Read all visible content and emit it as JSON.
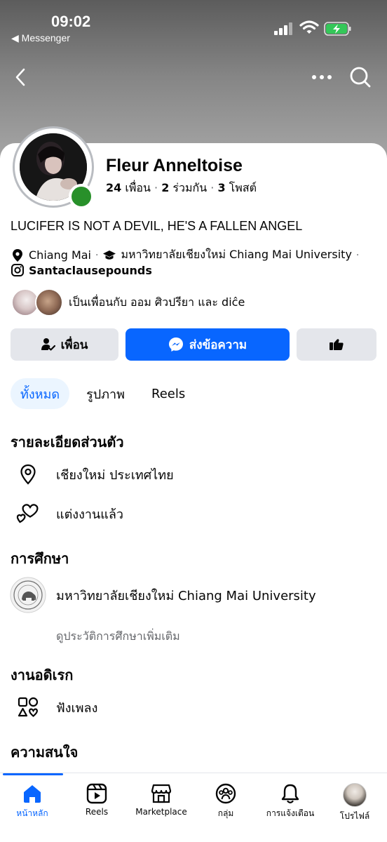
{
  "status_bar": {
    "time": "09:02",
    "back_app": "◀ Messenger"
  },
  "profile": {
    "name": "Fleur Anneltoise",
    "stats": {
      "friends": "24",
      "friends_label": "เพื่อน",
      "mutual": "2",
      "mutual_label": "ร่วมกัน",
      "posts": "3",
      "posts_label": "โพสต์"
    },
    "bio": "LUCIFER IS NOT A DEVIL, HE'S A FALLEN ANGEL",
    "location": "Chiang Mai",
    "school": "มหาวิทยาลัยเชียงใหม่ Chiang Mai University",
    "instagram": "Santaclausepounds",
    "mutual_text": "เป็นเพื่อนกับ ออม ศิวปรียา และ diĉe"
  },
  "actions": {
    "friend_label": "เพื่อน",
    "message_label": "ส่งข้อความ"
  },
  "tabs": [
    {
      "label": "ทั้งหมด"
    },
    {
      "label": "รูปภาพ"
    },
    {
      "label": "Reels"
    }
  ],
  "details": {
    "title": "รายละเอียดส่วนตัว",
    "location": "เชียงใหม่ ประเทศไทย",
    "relationship": "แต่งงานแล้ว"
  },
  "education": {
    "title": "การศึกษา",
    "school": "มหาวิทยาลัยเชียงใหม่ Chiang Mai University",
    "more_link": "ดูประวัติการศึกษาเพิ่มเติม"
  },
  "hobbies": {
    "title": "งานอดิเรก",
    "item": "ฟังเพลง"
  },
  "interests": {
    "title": "ความสนใจ"
  },
  "bottom_nav": [
    {
      "label": "หน้าหลัก"
    },
    {
      "label": "Reels"
    },
    {
      "label": "Marketplace"
    },
    {
      "label": "กลุ่ม"
    },
    {
      "label": "การแจ้งเตือน"
    },
    {
      "label": "โปรไฟล์"
    }
  ],
  "colors": {
    "accent": "#0866ff",
    "online": "#28902a",
    "button_gray": "#e4e6eb",
    "cover_top": "#5c5c5c"
  },
  "icons": [
    "back-arrow-icon",
    "more-icon",
    "search-icon",
    "location-pin-icon",
    "graduation-cap-icon",
    "instagram-icon",
    "friend-check-icon",
    "messenger-icon",
    "thumb-icon",
    "heart-icon",
    "university-seal-icon",
    "shapes-icon",
    "home-icon",
    "reels-icon",
    "store-icon",
    "group-icon",
    "bell-icon"
  ]
}
